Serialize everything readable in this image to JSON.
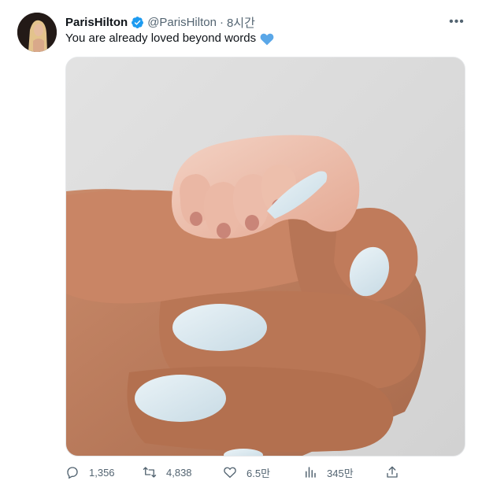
{
  "user": {
    "display_name": "ParisHilton",
    "handle": "@ParisHilton",
    "separator": "·",
    "time": "8시간",
    "verified": true
  },
  "tweet": {
    "text": "You are already loved beyond words",
    "emoji": "blue-heart",
    "media_icon": "baby-hand-holding-finger-photo"
  },
  "menu": {
    "icon": "more-options-icon"
  },
  "actions": {
    "reply_count": "1,356",
    "retweet_count": "4,838",
    "like_count": "6.5만",
    "view_count": "345만"
  },
  "colors": {
    "text": "#0f1419",
    "muted": "#536471",
    "verified": "#1d9bf0",
    "heart": "#5aa7e8",
    "nail": "#cfe1ea"
  }
}
